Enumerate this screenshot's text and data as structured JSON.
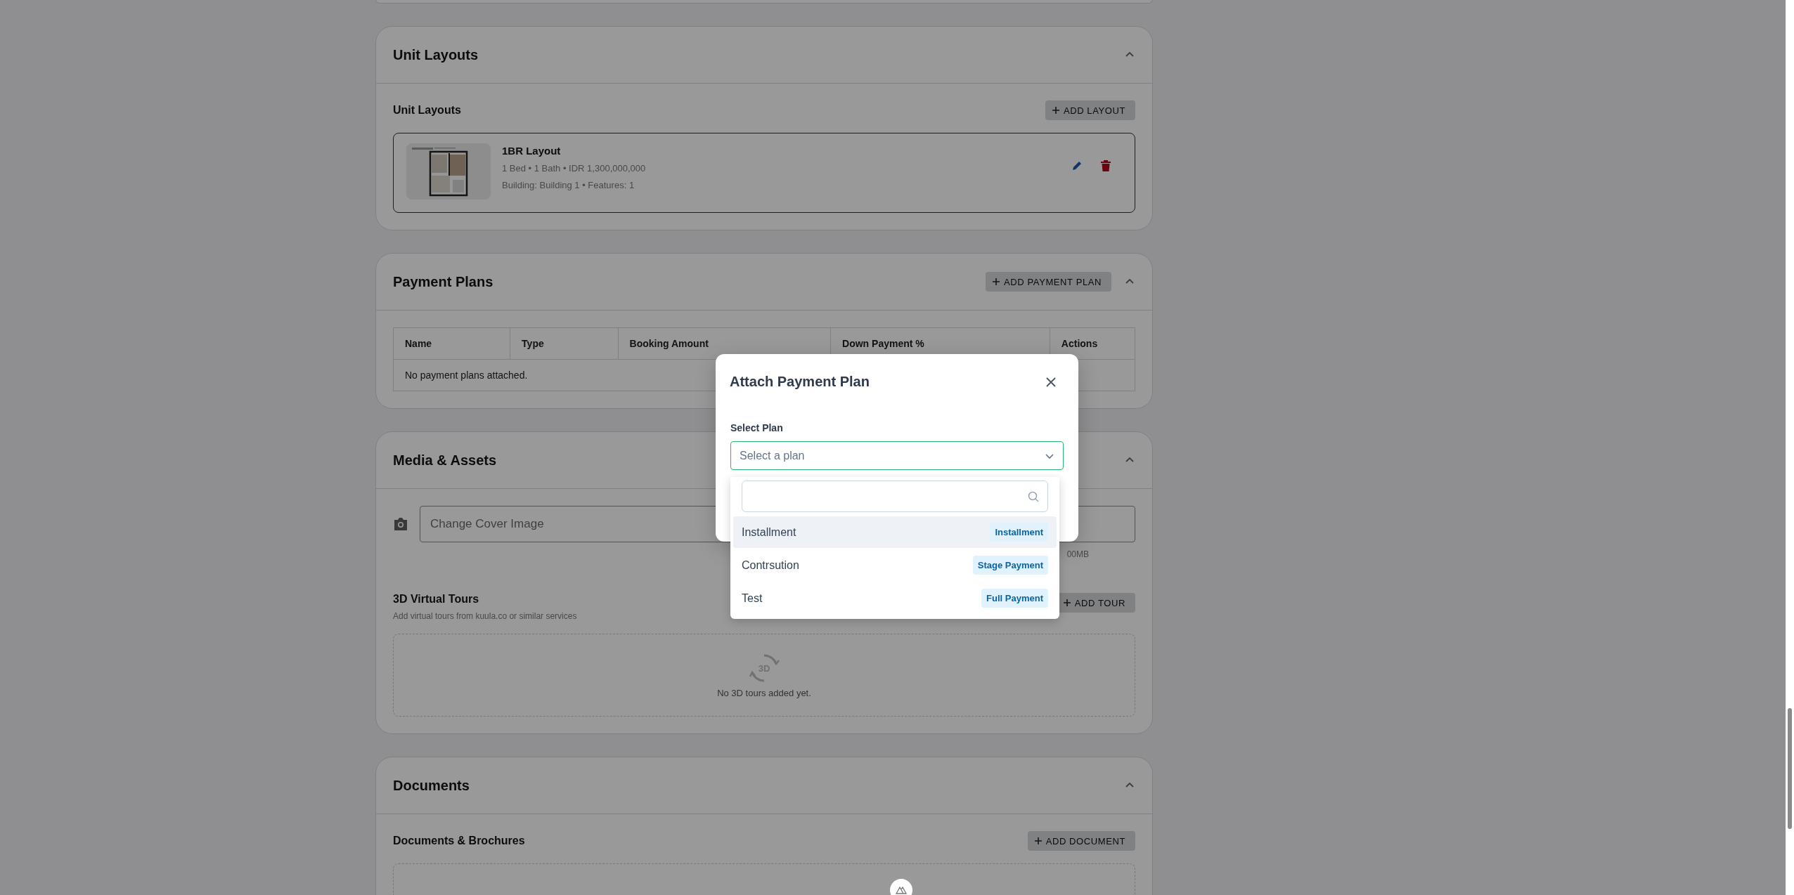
{
  "sections": [
    {
      "kind": "stub"
    },
    {
      "kind": "layouts",
      "title": "Unit Layouts",
      "expanded": true,
      "subtitle": "Unit Layouts",
      "add_button": "ADD LAYOUT",
      "layouts": [
        {
          "name": "1BR Layout",
          "details": "1 Bed • 1 Bath • IDR 1,300,000,000",
          "meta": "Building: Building 1 • Features: 1"
        }
      ]
    },
    {
      "kind": "payment_plans",
      "title": "Payment Plans",
      "expanded": true,
      "add_button": "ADD PAYMENT PLAN",
      "table": {
        "columns": [
          "Name",
          "Type",
          "Booking Amount",
          "Down Payment %",
          "Actions"
        ],
        "empty_text": "No payment plans attached."
      }
    },
    {
      "kind": "media",
      "title": "Media & Assets",
      "expanded": true,
      "cover_field": {
        "placeholder": "Change Cover Image",
        "hint": "00MB"
      },
      "tours": {
        "title": "3D Virtual Tours",
        "subtitle": "Add virtual tours from kuula.co or similar services",
        "add_button": "ADD TOUR",
        "icon_label": "3D",
        "empty_text": "No 3D tours added yet."
      }
    },
    {
      "kind": "documents",
      "title": "Documents",
      "expanded": true,
      "subtitle": "Documents & Brochures",
      "add_button": "ADD DOCUMENT"
    }
  ],
  "modal": {
    "title": "Attach Payment Plan",
    "field_label": "Select Plan",
    "select": {
      "placeholder": "Select a plan",
      "expanded": true
    },
    "options": [
      {
        "label": "Installment",
        "tag": "Installment",
        "highlighted": true
      },
      {
        "label": "Contrsution",
        "tag": "Stage Payment",
        "highlighted": false
      },
      {
        "label": "Test",
        "tag": "Full Payment",
        "highlighted": false
      }
    ]
  }
}
